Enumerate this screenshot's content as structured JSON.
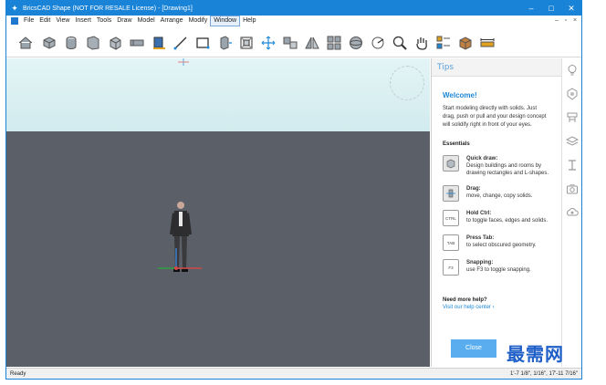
{
  "window": {
    "title": "BricsCAD Shape (NOT FOR RESALE License) - [Drawing1]",
    "controls": [
      "–",
      "□",
      "✕"
    ]
  },
  "menu": {
    "items": [
      "File",
      "Edit",
      "View",
      "Insert",
      "Tools",
      "Draw",
      "Model",
      "Arrange",
      "Modify",
      "Window",
      "Help"
    ],
    "active": "Window",
    "mdi_controls": [
      "–",
      "▫",
      "×"
    ]
  },
  "toolbar": {
    "tools": [
      "home-icon",
      "box-solid-icon",
      "cylinder-solid-icon",
      "wall-icon",
      "cube-icon",
      "beam-icon",
      "building-icon",
      "line-icon",
      "rectangle-icon",
      "push-pull-icon",
      "frame-icon",
      "move-icon",
      "copy-icon",
      "mirror-icon",
      "grid-array-icon",
      "sphere-icon",
      "measure-icon",
      "zoom-icon",
      "pan-hand-icon",
      "select-icon",
      "materials-icon",
      "dimension-icon"
    ]
  },
  "tips": {
    "header": "Tips",
    "welcome": "Welcome!",
    "intro": "Start modeling directly with solids. Just drag, push or pull and your design concept will solidify right in front of your eyes.",
    "essentials": "Essentials",
    "items": [
      {
        "icon": "cube-icon",
        "icon_text": "",
        "title": "Quick draw:",
        "text": "Design buildings and rooms by drawing rectangles and L-shapes."
      },
      {
        "icon": "drag-icon",
        "icon_text": "",
        "title": "Drag:",
        "text": "move, change, copy solids."
      },
      {
        "icon": "ctrl-key-icon",
        "icon_text": "CTRL",
        "title": "Hold Ctrl:",
        "text": "to toggle faces, edges and solids."
      },
      {
        "icon": "tab-key-icon",
        "icon_text": "TAB",
        "title": "Press Tab:",
        "text": "to select obscured geometry."
      },
      {
        "icon": "f3-key-icon",
        "icon_text": "F3",
        "title": "Snapping:",
        "text": "use F3 to toggle snapping."
      }
    ],
    "help_title": "Need more help?",
    "help_link": "Visit our help center ›",
    "close_label": "Close"
  },
  "side_panel": {
    "icons": [
      "lightbulb-icon",
      "tips-icon",
      "components-icon",
      "layers-icon",
      "properties-icon",
      "camera-icon",
      "cloud-icon"
    ]
  },
  "status": {
    "left": "Ready",
    "right": "1'-7 1/8\", 1/16\", 17'-11 7/16\""
  },
  "colors": {
    "titlebar": "#1883d7",
    "accent": "#1e88d8",
    "viewport": "#5a5f68",
    "close_button": "#5aaef0"
  },
  "watermark": "最需网"
}
